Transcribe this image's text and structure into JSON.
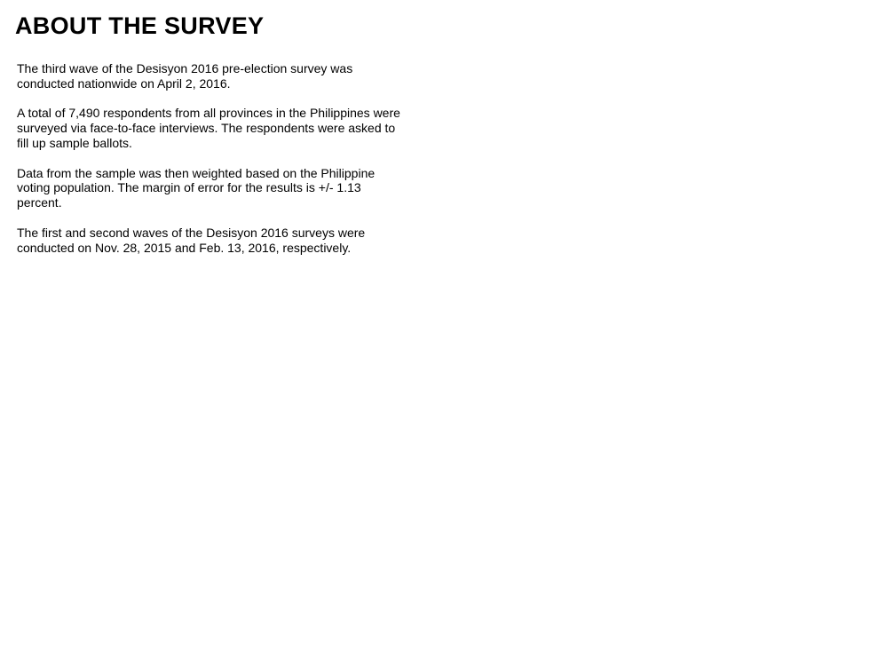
{
  "title": "ABOUT THE SURVEY",
  "paragraphs": [
    "The third wave of the Desisyon 2016 pre-election survey was conducted nationwide on April 2, 2016.",
    "A total of 7,490 respondents from all provinces in the Philippines were surveyed via face-to-face interviews. The respondents were asked to fill up sample ballots.",
    "Data from the sample was then weighted based on the Philippine voting population. The margin of error for the results is +/- 1.13 percent.",
    "The first and second waves of the Desisyon 2016 surveys were conducted on Nov. 28, 2015 and Feb. 13, 2016, respectively."
  ]
}
